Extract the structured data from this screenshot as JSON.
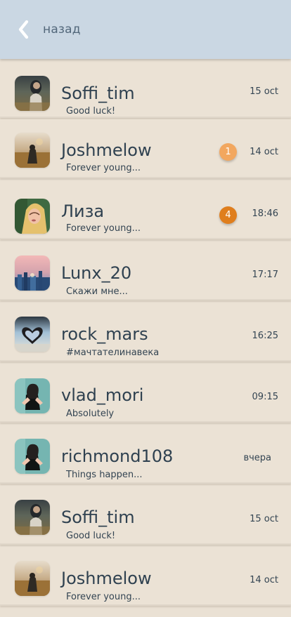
{
  "header": {
    "back_label": "назад",
    "background_color": "#cad7e3"
  },
  "colors": {
    "background": "#eae1d4",
    "text": "#2f4150",
    "badge_light": "#f2a75f",
    "badge_dark": "#df7e1d"
  },
  "chats": [
    {
      "name": "Soffi_tim",
      "message": "Good luck!",
      "time": "15 oct",
      "avatar_icon": "avatar-dark-field-photo"
    },
    {
      "name": "Joshmelow",
      "message": "Forever young...",
      "time": "14 oct",
      "unread": "1",
      "avatar_icon": "avatar-sunset-field-photo"
    },
    {
      "name": "Лиза",
      "message": "Forever young...",
      "time": "18:46",
      "unread": "4",
      "avatar_icon": "avatar-blonde-portrait-photo"
    },
    {
      "name": "Lunx_20",
      "message": "Скажи мне...",
      "time": "17:17",
      "avatar_icon": "avatar-city-sunset-photo"
    },
    {
      "name": "rock_mars",
      "message": "#мачтателинавека",
      "time": "16:25",
      "avatar_icon": "avatar-heart-sky-photo"
    },
    {
      "name": "vlad_mori",
      "message": "Absolutely",
      "time": "09:15",
      "avatar_icon": "avatar-girl-teal-photo"
    },
    {
      "name": "richmond108",
      "message": "Things happen...",
      "time": "вчера",
      "avatar_icon": "avatar-girl-teal-photo"
    },
    {
      "name": "Soffi_tim",
      "message": "Good luck!",
      "time": "15 oct",
      "avatar_icon": "avatar-dark-field-photo"
    },
    {
      "name": "Joshmelow",
      "message": "Forever young...",
      "time": "14 oct",
      "avatar_icon": "avatar-sunset-field-photo"
    }
  ]
}
